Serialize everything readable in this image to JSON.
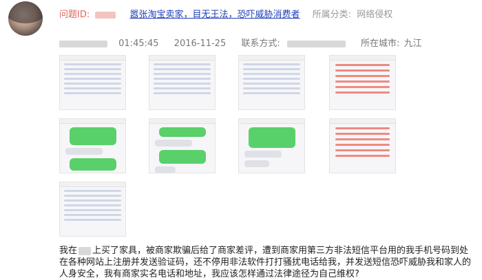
{
  "header": {
    "id_label": "问题ID:",
    "title": "嚣张淘宝卖家，目无王法，恐吓威胁消费者",
    "category_label": "所属分类:",
    "category_value": "网络侵权"
  },
  "meta": {
    "time": "01:45:45",
    "date": "2016-11-25",
    "contact_label": "联系方式:",
    "city_label": "所在城市:",
    "city_value": "九江"
  },
  "gallery": {
    "images": [
      "screenshot-1",
      "screenshot-2",
      "screenshot-3",
      "screenshot-4",
      "screenshot-5",
      "screenshot-6",
      "screenshot-7",
      "screenshot-8",
      "screenshot-9"
    ]
  },
  "body": {
    "prefix": "我在",
    "text": "上买了家具，被商家欺骗后给了商家差评，遭到商家用第三方非法短信平台用的我手机号码到处在各种网站上注册并发送验证码，还不停用非法软件打打骚扰电话给我，并发送短信恐吓威胁我和家人的人身安全，我有商家实名电话和地址，我应该怎样通过法律途径为自己维权?"
  }
}
